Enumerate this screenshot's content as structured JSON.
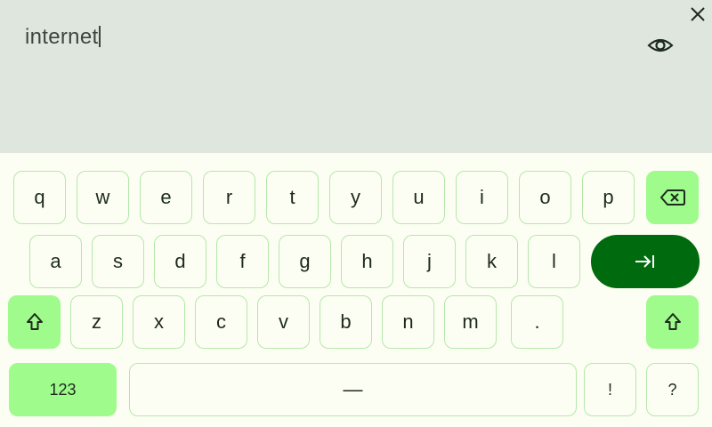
{
  "input": {
    "text": "internet"
  },
  "colors": {
    "accent": "#9efb8c",
    "enter": "#006b0e",
    "keyBorder": "#b5e7ab",
    "panel": "#dfe6de"
  },
  "icons": {
    "close": "close-icon",
    "visibility": "eye-icon",
    "backspace": "backspace-icon",
    "enter": "tab-arrow-icon",
    "shift": "shift-arrow-icon"
  },
  "keyboard": {
    "row1": [
      "q",
      "w",
      "e",
      "r",
      "t",
      "y",
      "u",
      "i",
      "o",
      "p"
    ],
    "row2": [
      "a",
      "s",
      "d",
      "f",
      "g",
      "h",
      "j",
      "k",
      "l"
    ],
    "row3": [
      "z",
      "x",
      "c",
      "v",
      "b",
      "n",
      "m",
      "."
    ],
    "row4": {
      "symbols": "123",
      "space": "—",
      "exclaim": "!",
      "question": "?"
    }
  }
}
